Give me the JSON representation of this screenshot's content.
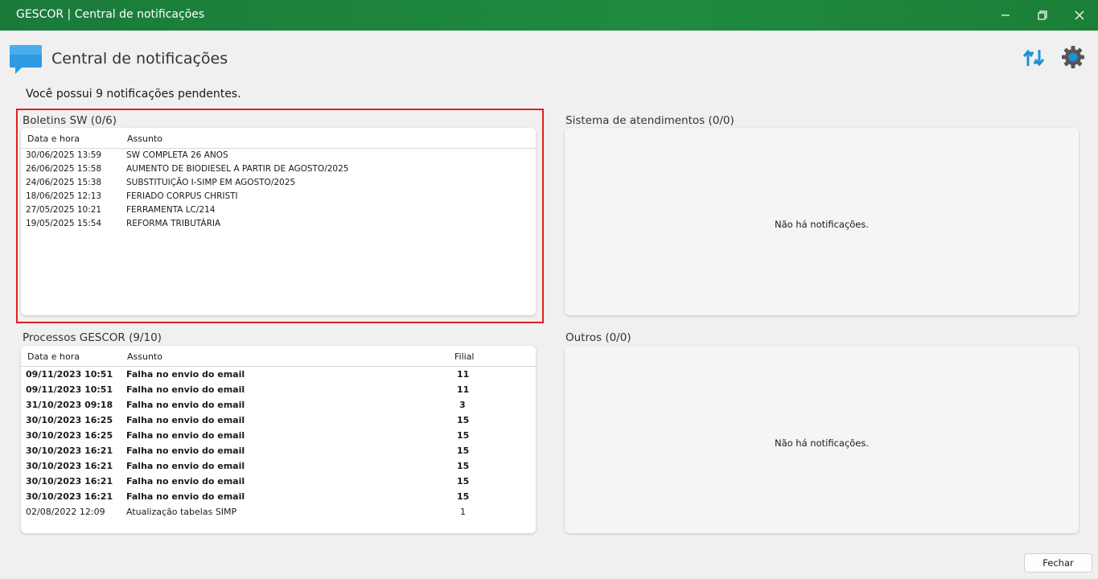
{
  "window": {
    "title": "GESCOR | Central de notificações",
    "minimize_glyph": "—",
    "maximize_glyph": "❐",
    "close_glyph": "✕"
  },
  "header": {
    "title": "Central de notificações",
    "icons": [
      "chat-bubble-icon",
      "sync-icon",
      "gear-icon"
    ]
  },
  "pending_text": "Você possui 9 notificações pendentes.",
  "boletins": {
    "label": "Boletins SW (0/6)",
    "headers": {
      "date": "Data e hora",
      "subject": "Assunto"
    },
    "rows": [
      {
        "date": "30/06/2025 13:59",
        "subject": "SW COMPLETA 26 ANOS"
      },
      {
        "date": "26/06/2025 15:58",
        "subject": "AUMENTO DE BIODIESEL A PARTIR DE AGOSTO/2025"
      },
      {
        "date": "24/06/2025 15:38",
        "subject": "SUBSTITUIÇÃO I-SIMP EM AGOSTO/2025"
      },
      {
        "date": "18/06/2025 12:13",
        "subject": "FERIADO CORPUS CHRISTI"
      },
      {
        "date": "27/05/2025 10:21",
        "subject": "FERRAMENTA LC/214"
      },
      {
        "date": "19/05/2025 15:54",
        "subject": "REFORMA TRIBUTÁRIA"
      }
    ]
  },
  "sistema": {
    "label": "Sistema de atendimentos (0/0)",
    "empty": "Não há notificações."
  },
  "processos": {
    "label": "Processos GESCOR (9/10)",
    "headers": {
      "date": "Data e hora",
      "subject": "Assunto",
      "branch": "Filial"
    },
    "rows": [
      {
        "date": "09/11/2023 10:51",
        "subject": "Falha no envio do email",
        "branch": "11",
        "unread": true
      },
      {
        "date": "09/11/2023 10:51",
        "subject": "Falha no envio do email",
        "branch": "11",
        "unread": true
      },
      {
        "date": "31/10/2023 09:18",
        "subject": "Falha no envio do email",
        "branch": "3",
        "unread": true
      },
      {
        "date": "30/10/2023 16:25",
        "subject": "Falha no envio do email",
        "branch": "15",
        "unread": true
      },
      {
        "date": "30/10/2023 16:25",
        "subject": "Falha no envio do email",
        "branch": "15",
        "unread": true
      },
      {
        "date": "30/10/2023 16:21",
        "subject": "Falha no envio do email",
        "branch": "15",
        "unread": true
      },
      {
        "date": "30/10/2023 16:21",
        "subject": "Falha no envio do email",
        "branch": "15",
        "unread": true
      },
      {
        "date": "30/10/2023 16:21",
        "subject": "Falha no envio do email",
        "branch": "15",
        "unread": true
      },
      {
        "date": "30/10/2023 16:21",
        "subject": "Falha no envio do email",
        "branch": "15",
        "unread": true
      },
      {
        "date": "02/08/2022 12:09",
        "subject": "Atualização tabelas SIMP",
        "branch": "1",
        "unread": false
      }
    ]
  },
  "outros": {
    "label": "Outros (0/0)",
    "empty": "Não há notificações."
  },
  "footer": {
    "close_label": "Fechar"
  },
  "colors": {
    "titlebar": "#1f8c3f",
    "accent": "#1e90d6",
    "highlight": "#e02020"
  }
}
